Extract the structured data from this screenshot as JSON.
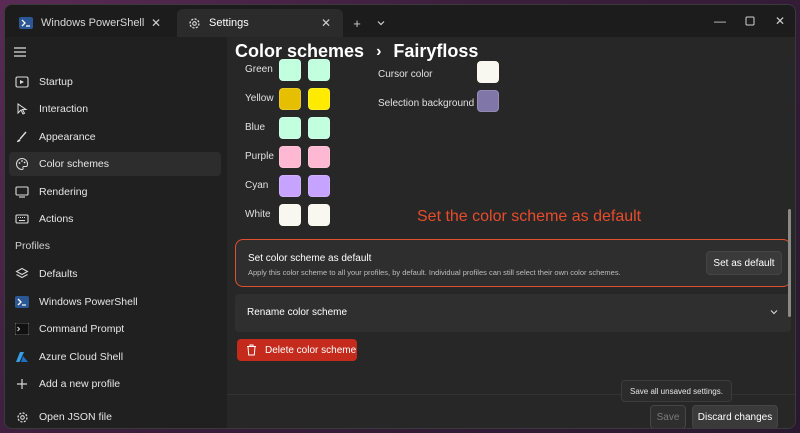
{
  "tabs": [
    {
      "label": "Windows PowerShell",
      "icon": "powershell-icon"
    },
    {
      "label": "Settings",
      "icon": "gear-icon"
    }
  ],
  "sidebar": {
    "items": [
      {
        "label": "Startup",
        "icon": "startup-icon"
      },
      {
        "label": "Interaction",
        "icon": "interaction-icon"
      },
      {
        "label": "Appearance",
        "icon": "paintbrush-icon"
      },
      {
        "label": "Color schemes",
        "icon": "palette-icon",
        "selected": true
      },
      {
        "label": "Rendering",
        "icon": "monitor-icon"
      },
      {
        "label": "Actions",
        "icon": "keyboard-icon"
      }
    ],
    "profiles_header": "Profiles",
    "profiles": [
      {
        "label": "Defaults",
        "icon": "layers-icon"
      },
      {
        "label": "Windows PowerShell",
        "icon": "powershell-icon"
      },
      {
        "label": "Command Prompt",
        "icon": "cmd-icon"
      },
      {
        "label": "Azure Cloud Shell",
        "icon": "azure-icon"
      },
      {
        "label": "Add a new profile",
        "icon": "plus-icon"
      }
    ],
    "open_json": {
      "label": "Open JSON file",
      "icon": "gear-icon"
    }
  },
  "header": {
    "section": "Color schemes",
    "scheme_name": "Fairyfloss"
  },
  "colors": {
    "left": [
      {
        "label": "Green",
        "colors": [
          "#c2ffdf",
          "#c2ffdf"
        ]
      },
      {
        "label": "Yellow",
        "colors": [
          "#e6c000",
          "#ffea00"
        ]
      },
      {
        "label": "Blue",
        "colors": [
          "#c2ffdf",
          "#c2ffdf"
        ]
      },
      {
        "label": "Purple",
        "colors": [
          "#ffb8d1",
          "#ffb8d1"
        ]
      },
      {
        "label": "Cyan",
        "colors": [
          "#c5a3ff",
          "#c5a3ff"
        ]
      },
      {
        "label": "White",
        "colors": [
          "#f8f8f0",
          "#f8f8f0"
        ]
      }
    ],
    "right": [
      {
        "label": "Cursor color",
        "color": "#f8f8f0"
      },
      {
        "label": "Selection background",
        "color": "#8077a8"
      }
    ]
  },
  "annotation": "Set the color scheme as default",
  "set_default": {
    "title": "Set color scheme as default",
    "description": "Apply this color scheme to all your profiles, by default. Individual profiles can still select their own color schemes.",
    "button": "Set as default"
  },
  "rename": {
    "label": "Rename color scheme"
  },
  "delete_button": "Delete color scheme",
  "tooltip": "Save all unsaved settings.",
  "footer": {
    "save": "Save",
    "discard": "Discard changes"
  },
  "theme": {
    "accent_red": "#c42b1c",
    "highlight_border": "#e0502c"
  }
}
